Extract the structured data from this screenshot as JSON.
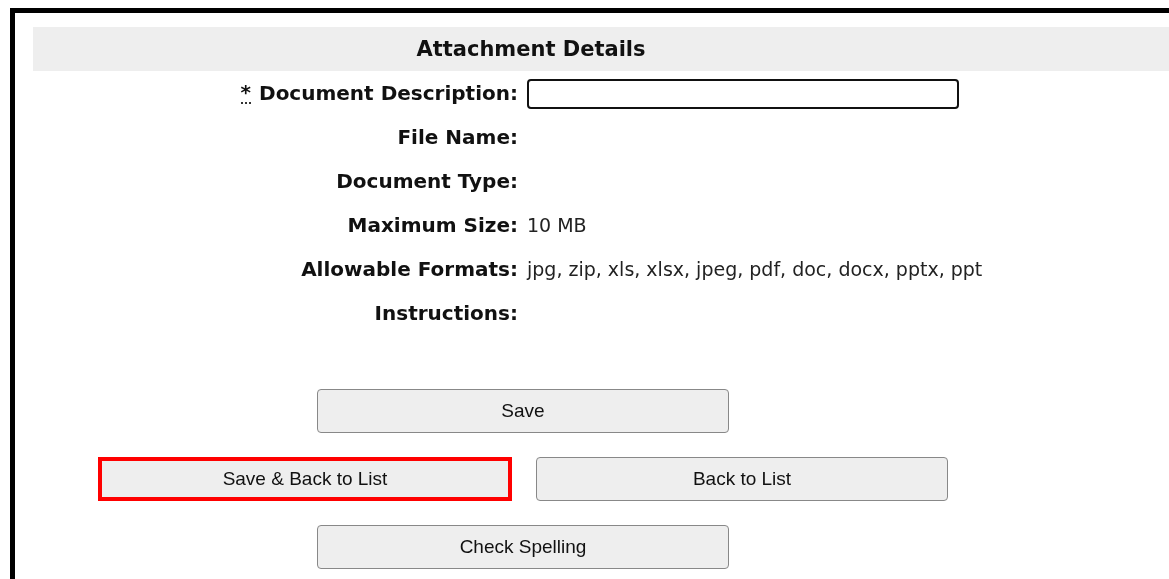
{
  "section": {
    "title": "Attachment Details"
  },
  "fields": [
    {
      "label": "Document Description:",
      "required_mark": "*",
      "kind": "input"
    },
    {
      "label": "File Name:",
      "kind": "text"
    },
    {
      "label": "Document Type:",
      "kind": "text"
    },
    {
      "label": "Maximum Size:",
      "kind": "text",
      "value": "10 MB"
    },
    {
      "label": "Allowable Formats:",
      "kind": "text",
      "value": "jpg, zip, xls, xlsx, jpeg, pdf, doc, docx, pptx, ppt"
    },
    {
      "label": "Instructions:",
      "kind": "text"
    }
  ],
  "button_rows": [
    [
      {
        "label": "Save",
        "highlighted": false
      }
    ],
    [
      {
        "label": "Save & Back to List",
        "highlighted": true
      },
      {
        "label": "Back to List",
        "highlighted": false
      }
    ],
    [
      {
        "label": "Check Spelling",
        "highlighted": false
      }
    ]
  ]
}
